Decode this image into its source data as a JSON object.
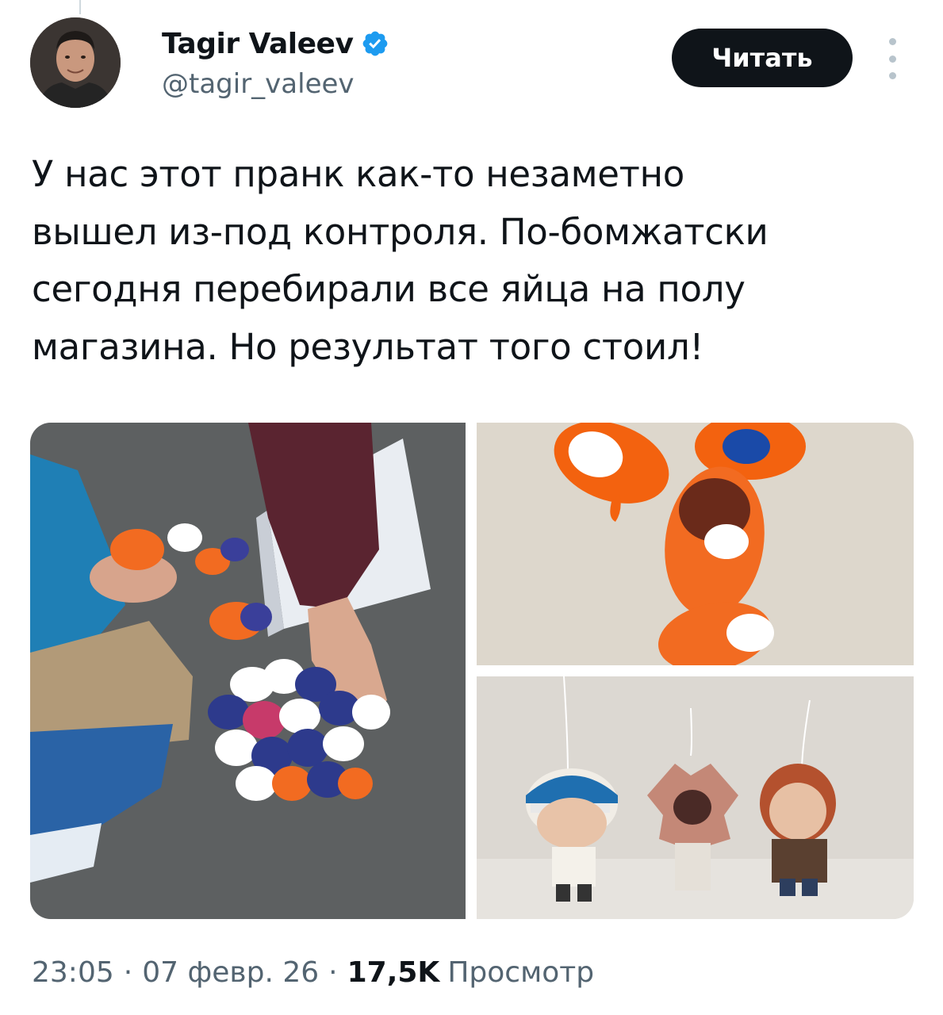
{
  "author": {
    "name": "Tagir Valeev",
    "handle": "@tagir_valeev",
    "verified_icon": "verified-badge-icon",
    "verified_color": "#1d9bf0"
  },
  "follow_button": {
    "label": "Читать"
  },
  "more_menu": {
    "icon": "more-vertical-icon"
  },
  "tweet": {
    "text": "У нас этот пранк как-то незаметно\nвышел из-под контроля. По-бомжатски\nсегодня перебирали все яйца на полу\nмагазина. Но результат того стоил!"
  },
  "meta": {
    "time": "23:05",
    "separator": "·",
    "date": "07 февр. 26",
    "views_count": "17,5K",
    "views_label": "Просмотр"
  },
  "colors": {
    "text": "#0f1419",
    "secondary": "#536471",
    "button_bg": "#0f1419",
    "button_text": "#ffffff"
  }
}
